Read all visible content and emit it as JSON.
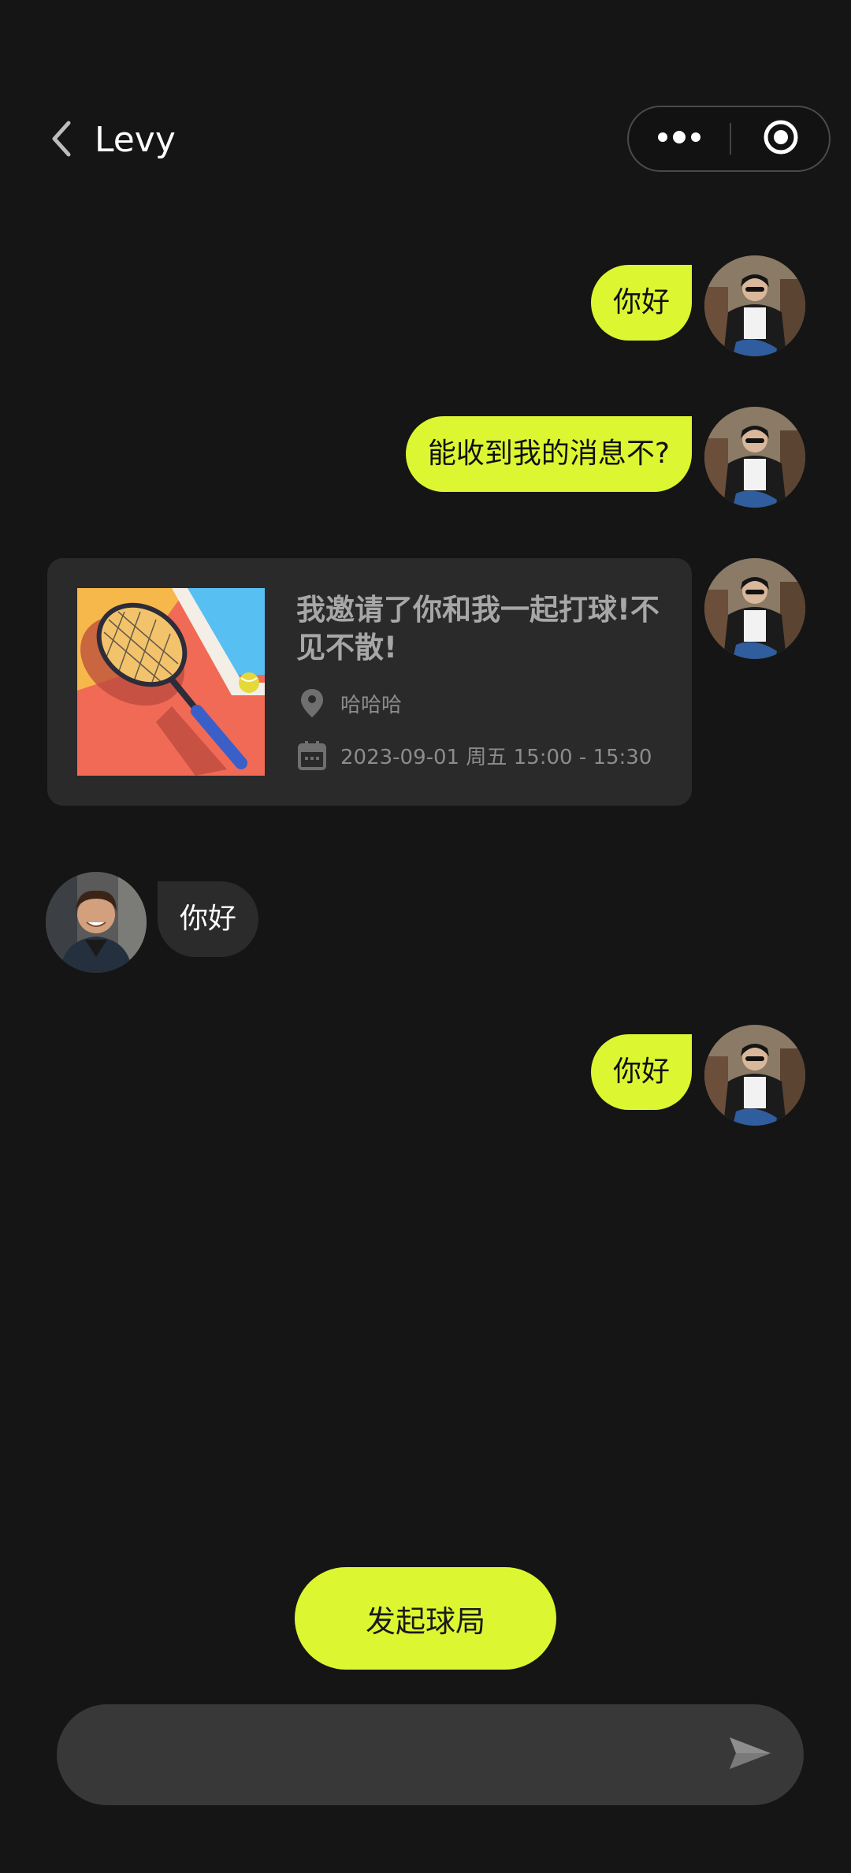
{
  "header": {
    "title": "Levy",
    "back_icon": "chevron-left-icon",
    "more_icon": "more-dots-icon",
    "close_icon": "target-circle-icon"
  },
  "messages": [
    {
      "from": "me",
      "type": "text",
      "text": "你好"
    },
    {
      "from": "me",
      "type": "text",
      "text": "能收到我的消息不?"
    },
    {
      "from": "me",
      "type": "invite_card",
      "title": "我邀请了你和我一起打球!不见不散!",
      "location_icon": "location-pin-icon",
      "location": "哈哈哈",
      "date_icon": "calendar-icon",
      "datetime": "2023-09-01 周五 15:00 - 15:30"
    },
    {
      "from": "other",
      "type": "text",
      "text": "你好"
    },
    {
      "from": "me",
      "type": "text",
      "text": "你好"
    }
  ],
  "footer": {
    "start_button_label": "发起球局",
    "input_value": "",
    "input_placeholder": "",
    "send_icon": "send-arrow-icon"
  },
  "colors": {
    "background": "#151515",
    "accent": "#dcf731",
    "card": "#2a2a2a",
    "input": "#383838"
  }
}
